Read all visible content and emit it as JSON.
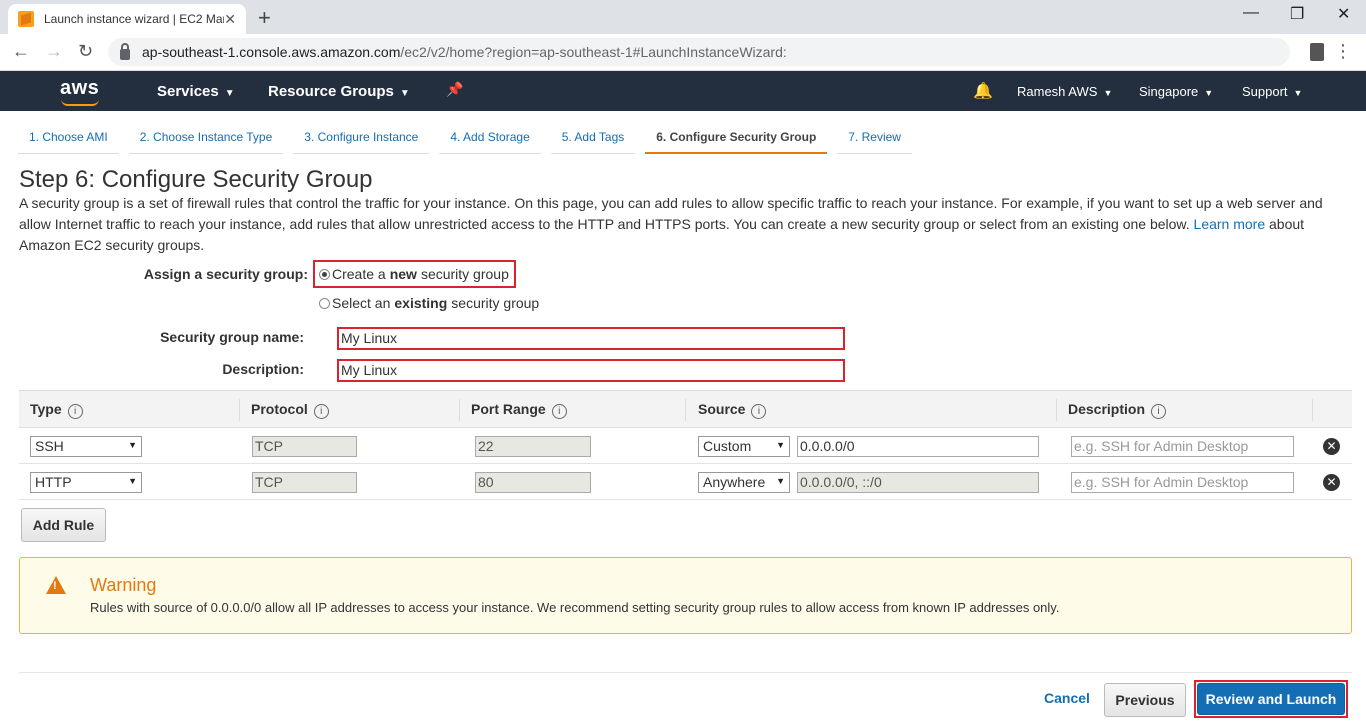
{
  "browser": {
    "tab_title": "Launch instance wizard | EC2 Management Console",
    "tab_close": "✕",
    "new_tab": "+",
    "url_host": "ap-southeast-1.console.aws.amazon.com",
    "url_path": "/ec2/v2/home?region=ap-southeast-1#LaunchInstanceWizard:"
  },
  "aws_header": {
    "logo": "aws",
    "services": "Services",
    "resource_groups": "Resource Groups",
    "user": "Ramesh AWS",
    "region": "Singapore",
    "support": "Support"
  },
  "steps": [
    "1. Choose AMI",
    "2. Choose Instance Type",
    "3. Configure Instance",
    "4. Add Storage",
    "5. Add Tags",
    "6. Configure Security Group",
    "7. Review"
  ],
  "page": {
    "title": "Step 6: Configure Security Group",
    "intro": "A security group is a set of firewall rules that control the traffic for your instance. On this page, you can add rules to allow specific traffic to reach your instance. For example, if you want to set up a web server and allow Internet traffic to reach your instance, add rules that allow unrestricted access to the HTTP and HTTPS ports. You can create a new security group or select from an existing one below.",
    "learn_more": "Learn more",
    "intro_tail": "about Amazon EC2 security groups."
  },
  "form": {
    "assign_label": "Assign a security group:",
    "opt_new_pre": "Create a ",
    "opt_new_bold": "new",
    "opt_new_post": " security group",
    "opt_existing_pre": "Select an ",
    "opt_existing_bold": "existing",
    "opt_existing_post": " security group",
    "name_label": "Security group name:",
    "name_value": "My Linux",
    "desc_label": "Description:",
    "desc_value": "My Linux"
  },
  "table": {
    "headers": [
      "Type",
      "Protocol",
      "Port Range",
      "Source",
      "Description"
    ],
    "rows": [
      {
        "type": "SSH",
        "protocol": "TCP",
        "port": "22",
        "source_mode": "Custom",
        "source": "0.0.0.0/0",
        "desc_placeholder": "e.g. SSH for Admin Desktop"
      },
      {
        "type": "HTTP",
        "protocol": "TCP",
        "port": "80",
        "source_mode": "Anywhere",
        "source": "0.0.0.0/0, ::/0",
        "desc_placeholder": "e.g. SSH for Admin Desktop"
      }
    ],
    "add_rule": "Add Rule"
  },
  "warning": {
    "title": "Warning",
    "text": "Rules with source of 0.0.0.0/0 allow all IP addresses to access your instance. We recommend setting security group rules to allow access from known IP addresses only."
  },
  "footer": {
    "cancel": "Cancel",
    "previous": "Previous",
    "review": "Review and Launch"
  }
}
